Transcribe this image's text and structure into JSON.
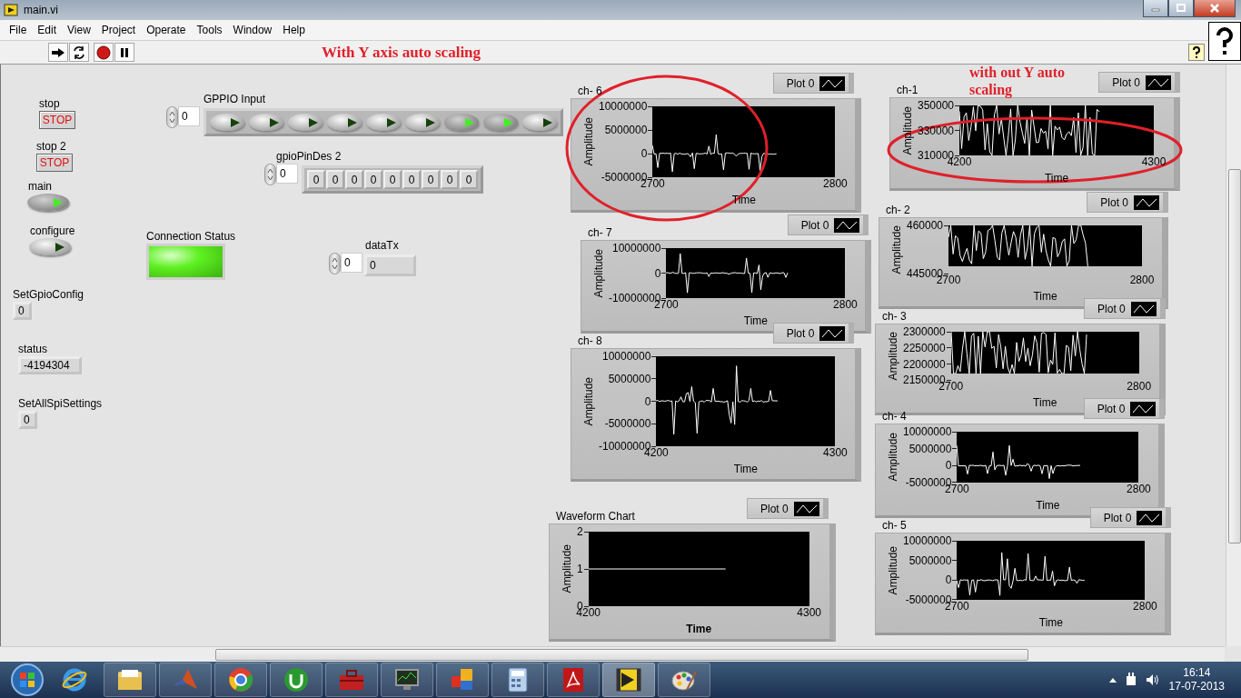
{
  "window": {
    "title": "main.vi"
  },
  "menu": [
    "File",
    "Edit",
    "View",
    "Project",
    "Operate",
    "Tools",
    "Window",
    "Help"
  ],
  "annotations": [
    "With Y axis auto scaling",
    "with out Y auto scaling"
  ],
  "controls": [
    {
      "kind": "stop_button",
      "label": "stop",
      "text": "STOP"
    },
    {
      "kind": "stop_button",
      "label": "stop 2",
      "text": "STOP"
    },
    {
      "kind": "toggle",
      "label": "main",
      "on": true
    },
    {
      "kind": "toggle",
      "label": "configure",
      "on": false
    },
    {
      "kind": "indicator",
      "label": "SetGpioConfig",
      "value": "0"
    },
    {
      "kind": "indicator",
      "label": "status",
      "value": "-4194304"
    },
    {
      "kind": "indicator",
      "label": "SetAllSpiSettings",
      "value": "0"
    },
    {
      "kind": "toggle_array",
      "label": "GPPIO Input",
      "index": "0",
      "items": [
        {
          "on": false
        },
        {
          "on": false
        },
        {
          "on": false
        },
        {
          "on": false
        },
        {
          "on": false
        },
        {
          "on": false
        },
        {
          "on": true
        },
        {
          "on": true
        },
        {
          "on": false
        }
      ]
    },
    {
      "kind": "number_array",
      "label": "gpioPinDes 2",
      "index": "0",
      "items": [
        "0",
        "0",
        "0",
        "0",
        "0",
        "0",
        "0",
        "0",
        "0"
      ]
    },
    {
      "kind": "led",
      "label": "Connection Status",
      "on": true
    },
    {
      "kind": "indexed_indicator",
      "label": "dataTx",
      "index": "0",
      "value": "0"
    }
  ],
  "charts": [
    {
      "label": "ch- 6",
      "legend": "Plot 0",
      "y_label": "Amplitude",
      "x_label": "Time",
      "y_ticks": [
        "10000000",
        "5000000",
        "0",
        "-5000000"
      ],
      "x_ticks": [
        "2700",
        "2800"
      ],
      "kind": "spikes"
    },
    {
      "label": "ch- 7",
      "legend": "Plot 0",
      "y_label": "Amplitude",
      "x_label": "Time",
      "y_ticks": [
        "10000000",
        "0",
        "-10000000"
      ],
      "x_ticks": [
        "2700",
        "2800"
      ],
      "kind": "spikes"
    },
    {
      "label": "ch- 8",
      "legend": "Plot 0",
      "y_label": "Amplitude",
      "x_label": "Time",
      "y_ticks": [
        "10000000",
        "5000000",
        "0",
        "-5000000",
        "-10000000"
      ],
      "x_ticks": [
        "4200",
        "4300"
      ],
      "kind": "spikes"
    },
    {
      "label": "Waveform Chart",
      "legend": "Plot 0",
      "y_label": "Amplitude",
      "x_label": "Time",
      "y_ticks": [
        "2",
        "1",
        "0"
      ],
      "x_ticks": [
        "4200",
        "4300"
      ],
      "kind": "flat"
    },
    {
      "label": "ch-1",
      "legend": "Plot 0",
      "y_label": "Amplitude",
      "x_label": "Time",
      "y_ticks": [
        "350000",
        "330000",
        "310000"
      ],
      "x_ticks": [
        "4200",
        "4300"
      ],
      "kind": "noise"
    },
    {
      "label": "ch- 2",
      "legend": "Plot 0",
      "y_label": "Amplitude",
      "x_label": "Time",
      "y_ticks": [
        "460000",
        "445000"
      ],
      "x_ticks": [
        "2700",
        "2800"
      ],
      "kind": "noise"
    },
    {
      "label": "ch- 3",
      "legend": "Plot 0",
      "y_label": "Amplitude",
      "x_label": "Time",
      "y_ticks": [
        "2300000",
        "2250000",
        "2200000",
        "2150000"
      ],
      "x_ticks": [
        "2700",
        "2800"
      ],
      "kind": "noise"
    },
    {
      "label": "ch- 4",
      "legend": "Plot 0",
      "y_label": "Amplitude",
      "x_label": "Time",
      "y_ticks": [
        "10000000",
        "5000000",
        "0",
        "-5000000"
      ],
      "x_ticks": [
        "2700",
        "2800"
      ],
      "kind": "spikes"
    },
    {
      "label": "ch- 5",
      "legend": "Plot 0",
      "y_label": "Amplitude",
      "x_label": "Time",
      "y_ticks": [
        "10000000",
        "5000000",
        "0",
        "-5000000"
      ],
      "x_ticks": [
        "2700",
        "2800"
      ],
      "kind": "spikes"
    }
  ],
  "taskbar": {
    "time": "16:14",
    "date": "17-07-2013"
  }
}
